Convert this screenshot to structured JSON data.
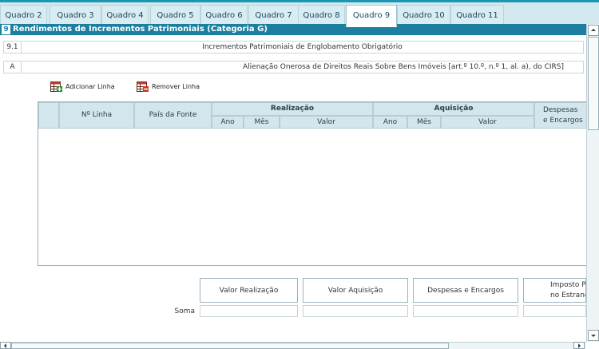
{
  "tabs": [
    "Quadro 2",
    "Quadro 3",
    "Quadro 4",
    "Quadro 5",
    "Quadro 6",
    "Quadro 7",
    "Quadro 8",
    "Quadro 9",
    "Quadro 10",
    "Quadro 11"
  ],
  "active_tab": "Quadro 9",
  "section": {
    "number": "9",
    "title": "Rendimentos de Incrementos Patrimoniais (Categoria G)"
  },
  "row_9_1": {
    "number": "9.1",
    "text": "Incrementos Patrimoniais de Englobamento Obrigatório"
  },
  "row_a": {
    "number": "A",
    "text": "Alienação Onerosa de Direitos Reais Sobre Bens Imóveis [art.º 10.º, n.º 1, al. a), do CIRS]"
  },
  "actions": {
    "add_label": "Adicionar Linha",
    "remove_label": "Remover Linha"
  },
  "table": {
    "col_line": "Nº Linha",
    "col_country": "País da Fonte",
    "group_realizacao": "Realização",
    "group_aquisicao": "Aquisição",
    "col_ano": "Ano",
    "col_mes": "Mês",
    "col_valor": "Valor",
    "col_despesas_line1": "Despesas",
    "col_despesas_line2": "e Encargos",
    "rows": []
  },
  "totals": {
    "valor_realizacao": "Valor Realização",
    "valor_aquisicao": "Valor Aquisição",
    "despesas_encargos": "Despesas e Encargos",
    "imposto_line1": "Imposto Pago",
    "imposto_line2": "no Estrangeiro",
    "soma_label": "Soma"
  },
  "colors": {
    "accent": "#1c7fa0",
    "tab_bg": "#d9ecf2",
    "header_cell": "#d3e6ed"
  }
}
